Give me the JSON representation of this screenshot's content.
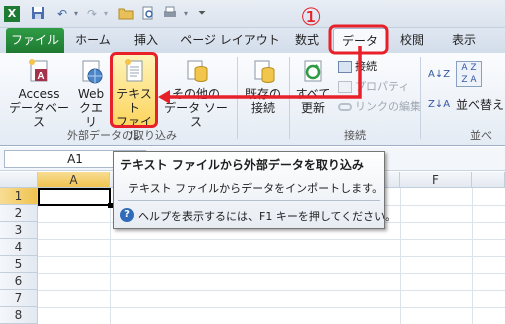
{
  "quick_access": {
    "icons": [
      "excel-logo-icon",
      "save-icon",
      "undo-icon",
      "redo-icon",
      "open-folder-icon",
      "print-preview-icon",
      "quick-print-icon",
      "customize-toolbar-icon"
    ]
  },
  "tabs": {
    "file": "ファイル",
    "home": "ホーム",
    "insert": "挿入",
    "page_layout": "ページ レイアウト",
    "formulas": "数式",
    "data": "データ",
    "review": "校閲",
    "view": "表示"
  },
  "ribbon": {
    "access_line1": "Access",
    "access_line2": "データベース",
    "web_line1": "Web",
    "web_line2": "クエリ",
    "text_line1": "テキスト",
    "text_line2": "ファイル",
    "other_line1": "その他の",
    "other_line2": "データ ソース",
    "existing_line1": "既存の",
    "existing_line2": "接続",
    "refresh_line1": "すべて",
    "refresh_line2": "更新",
    "connections": "接続",
    "properties": "プロパティ",
    "edit_links": "リンクの編集",
    "sort": "並べ替え",
    "group_external": "外部データの取り込み",
    "group_connections": "接続",
    "group_sort_partial": "並べ"
  },
  "annotation": {
    "step_number": "①",
    "color": "#e8202a"
  },
  "formula_bar": {
    "name_box": "A1"
  },
  "grid": {
    "columns": [
      "A",
      "F"
    ],
    "rows": [
      "1",
      "2",
      "3",
      "4",
      "5",
      "6",
      "7",
      "8"
    ]
  },
  "tooltip": {
    "title": "テキスト ファイルから外部データを取り込み",
    "body": "テキスト ファイルからデータをインポートします。",
    "help": "ヘルプを表示するには、F1 キーを押してください。"
  },
  "colors": {
    "file_tab": "#1f7a32",
    "selection_border": "#000000",
    "highlight_fill": "#fde38a"
  }
}
